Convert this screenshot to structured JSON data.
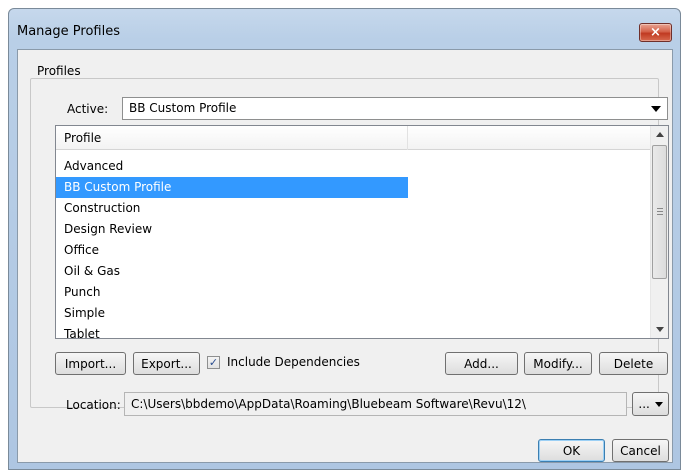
{
  "window": {
    "title": "Manage Profiles",
    "close_glyph": "×"
  },
  "profiles_group": {
    "label": "Profiles",
    "active_label": "Active:",
    "active_value": "BB Custom Profile"
  },
  "list": {
    "header": "Profile",
    "items": [
      "Advanced",
      "BB Custom Profile",
      "Construction",
      "Design Review",
      "Office",
      "Oil & Gas",
      "Punch",
      "Simple",
      "Tablet"
    ],
    "selected": "BB Custom Profile"
  },
  "buttons": {
    "import": "Import...",
    "export": "Export...",
    "include_dependencies": "Include Dependencies",
    "add": "Add...",
    "modify": "Modify...",
    "delete": "Delete",
    "ok": "OK",
    "cancel": "Cancel",
    "browse": "..."
  },
  "include_dependencies_checked": true,
  "location": {
    "label": "Location:",
    "value": "C:\\Users\\bbdemo\\AppData\\Roaming\\Bluebeam Software\\Revu\\12\\"
  },
  "icons": {
    "close": "close-icon",
    "dropdown": "chevron-down-icon",
    "check": "check-icon"
  }
}
